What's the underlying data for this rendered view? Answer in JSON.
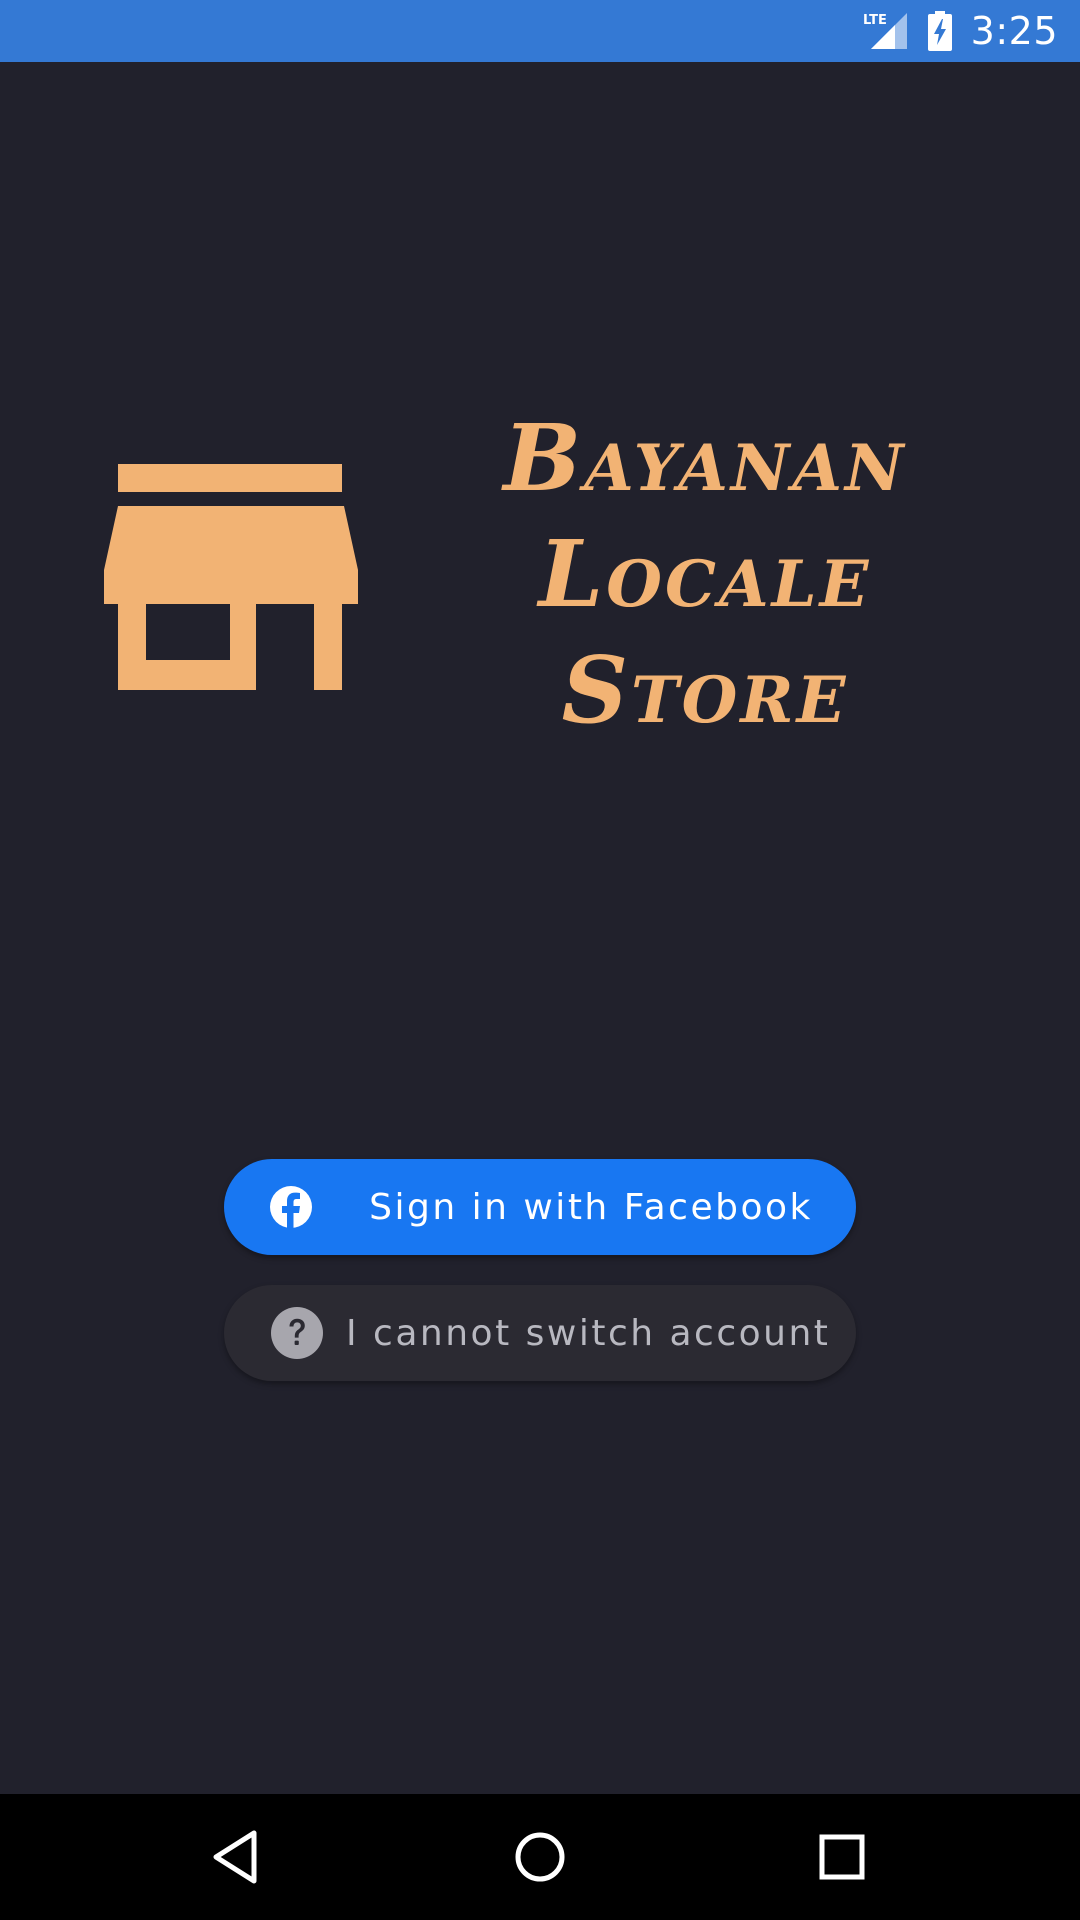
{
  "status_bar": {
    "network_label": "LTE",
    "time": "3:25",
    "background_color": "#3479d4"
  },
  "brand": {
    "icon": "storefront-icon",
    "title_lines": [
      "Bayanan",
      "Locale",
      "Store"
    ],
    "accent_color": "#f2b374"
  },
  "buttons": {
    "facebook": {
      "label": "Sign in with Facebook",
      "icon": "facebook-icon",
      "color": "#1877f2"
    },
    "cannot_switch": {
      "label": "I cannot switch account",
      "icon": "help-circle-icon",
      "color": "#2b2a32"
    }
  },
  "nav_bar": {
    "items": [
      "back-icon",
      "home-icon",
      "recents-icon"
    ]
  },
  "theme": {
    "background": "#21212c"
  }
}
